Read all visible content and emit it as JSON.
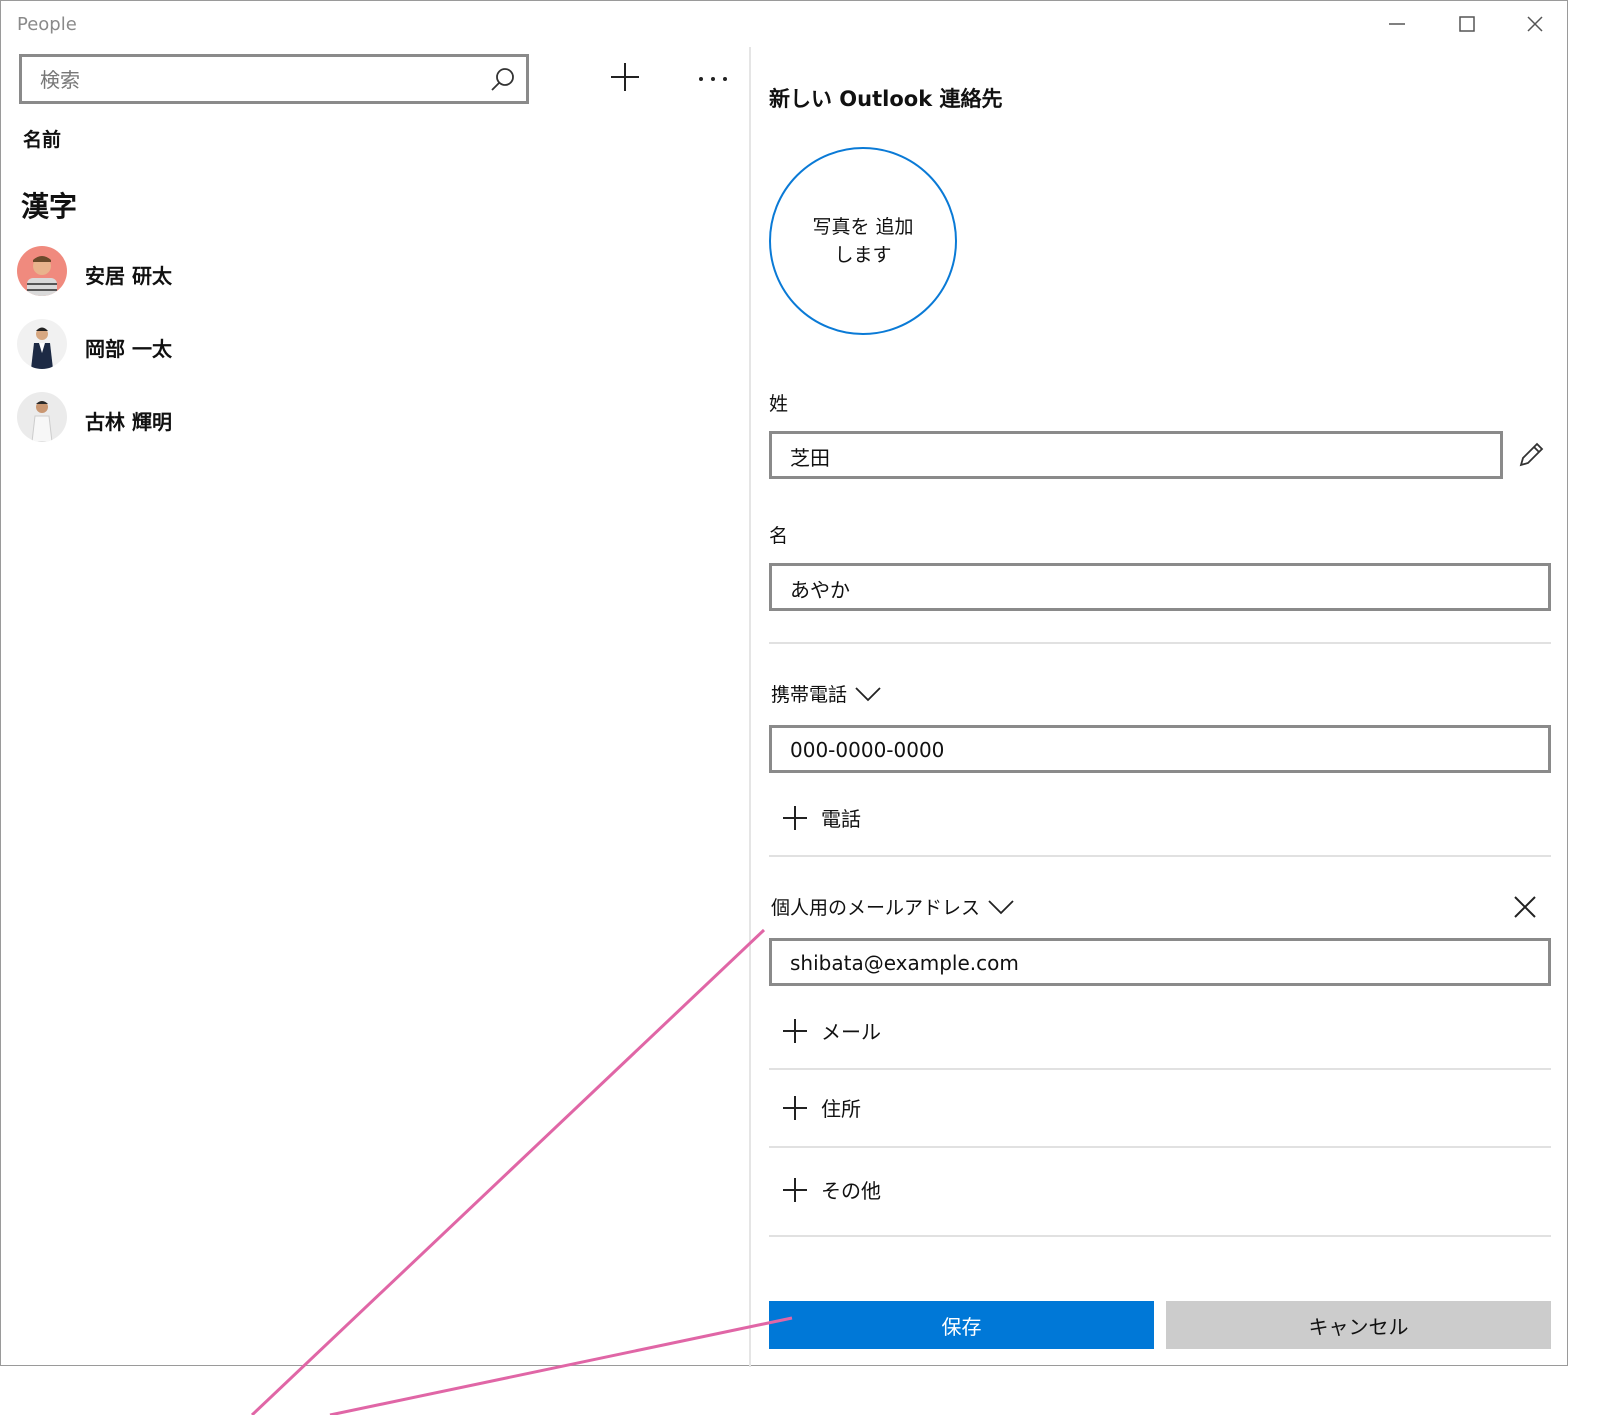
{
  "app": {
    "title": "People"
  },
  "left": {
    "search_placeholder": "検索",
    "sort_label": "名前",
    "group_header": "漢字",
    "contacts": [
      {
        "name": "安居 研太"
      },
      {
        "name": "岡部 一太"
      },
      {
        "name": "古林 輝明"
      }
    ]
  },
  "form": {
    "title": "新しい Outlook 連絡先",
    "photo_label": "写真を 追加します",
    "last_name_label": "姓",
    "last_name_value": "芝田",
    "first_name_label": "名",
    "first_name_value": "あやか",
    "phone_type": "携帯電話",
    "phone_value": "000-0000-0000",
    "add_phone": "電話",
    "email_type": "個人用のメールアドレス",
    "email_value": "shibata@example.com",
    "add_email": "メール",
    "add_address": "住所",
    "add_other": "その他",
    "save_label": "保存",
    "cancel_label": "キャンセル"
  },
  "colors": {
    "accent": "#0078d7",
    "annotation": "#e066a6"
  },
  "icons": [
    "search-icon",
    "plus-icon",
    "more-icon",
    "pencil-icon",
    "chevron-down-icon",
    "close-icon",
    "minimize-icon",
    "maximize-icon"
  ]
}
